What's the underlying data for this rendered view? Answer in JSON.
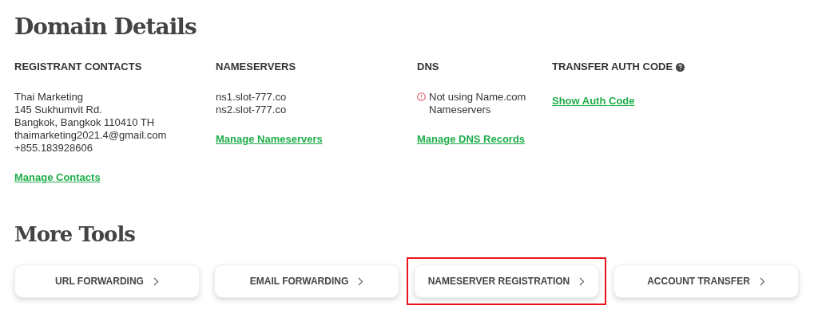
{
  "title": "Domain Details",
  "sections": [
    {
      "kind": "contacts",
      "heading": "REGISTRANT CONTACTS",
      "lines": [
        "Thai Marketing",
        "145 Sukhumvit Rd.",
        "Bangkok, Bangkok 110410 TH",
        "thaimarketing2021.4@gmail.com",
        "+855.183928606"
      ],
      "link": "Manage Contacts"
    },
    {
      "kind": "nameservers",
      "heading": "NAMESERVERS",
      "lines": [
        "ns1.slot-777.co",
        "ns2.slot-777.co"
      ],
      "link": "Manage Nameservers"
    },
    {
      "kind": "warning",
      "heading": "DNS",
      "lines": [
        "Not using Name.com Nameservers"
      ],
      "link": "Manage DNS Records"
    },
    {
      "kind": "help",
      "heading": "TRANSFER AUTH CODE",
      "link": "Show Auth Code"
    }
  ],
  "tools_title": "More Tools",
  "tools": [
    {
      "label": "URL FORWARDING",
      "highlighted": false
    },
    {
      "label": "EMAIL FORWARDING",
      "highlighted": false
    },
    {
      "label": "NAMESERVER REGISTRATION",
      "highlighted": true
    },
    {
      "label": "ACCOUNT TRANSFER",
      "highlighted": false
    }
  ]
}
